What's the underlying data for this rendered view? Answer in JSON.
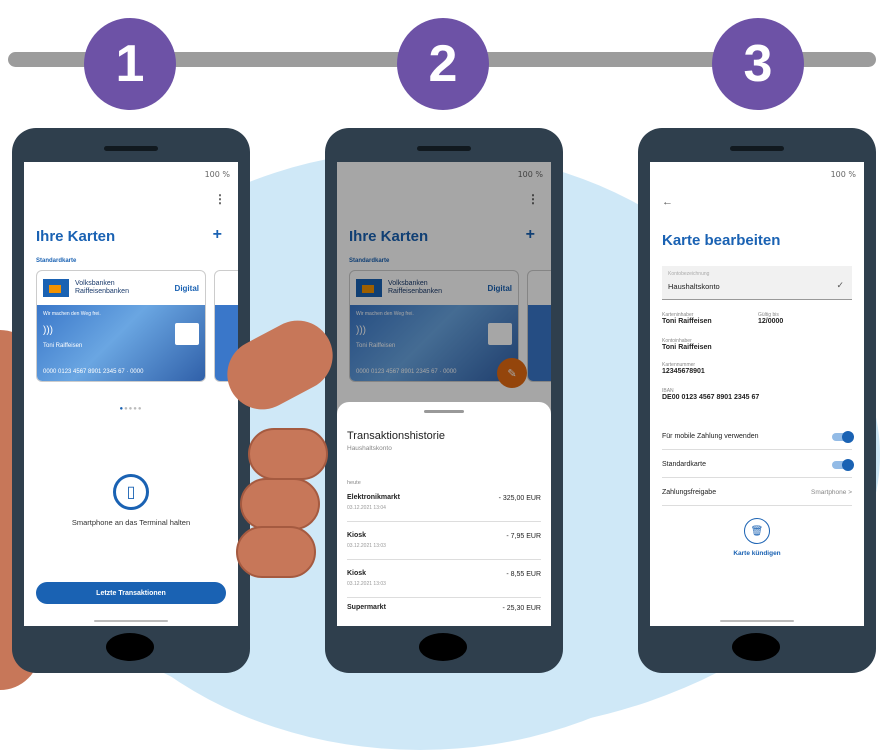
{
  "steps": [
    "1",
    "2",
    "3"
  ],
  "status_bar": "100 %",
  "phone1": {
    "title": "Ihre Karten",
    "add": "+",
    "section": "Standardkarte",
    "card": {
      "bank_line1": "Volksbanken",
      "bank_line2": "Raiffeisenbanken",
      "type": "Digital",
      "slogan": "Wir machen den Weg frei.",
      "holder": "Toni Raiffeisen",
      "number": "0000 0123 4567 8901 2345 67 · 0000"
    },
    "hint": "Smartphone an das Terminal halten",
    "button": "Letzte Transaktionen"
  },
  "phone2": {
    "sheet_title": "Transaktionshistorie",
    "sheet_subtitle": "Haushaltskonto",
    "today": "heute",
    "transactions": [
      {
        "name": "Elektronikmarkt",
        "date": "03.12.2021 13:04",
        "amount": "- 325,00 EUR"
      },
      {
        "name": "Kiosk",
        "date": "03.12.2021 13:03",
        "amount": "- 7,95 EUR"
      },
      {
        "name": "Kiosk",
        "date": "03.12.2021 13:03",
        "amount": "- 8,55 EUR"
      },
      {
        "name": "Supermarkt",
        "date": "",
        "amount": "- 25,30 EUR"
      }
    ]
  },
  "phone3": {
    "back": "←",
    "title": "Karte bearbeiten",
    "field_placeholder": "Kontobezeichnung",
    "field_value": "Haushaltskonto",
    "cardholder_label": "Karteninhaber",
    "cardholder": "Toni Raiffeisen",
    "valid_label": "Gültig bis",
    "valid": "12/0000",
    "account_holder_label": "Kontoinhaber",
    "account_holder": "Toni Raiffeisen",
    "card_number_label": "Kartennummer",
    "card_number": "12345678901",
    "iban_label": "IBAN",
    "iban": "DE00 0123 4567 8901 2345 67",
    "mobile_pay": "Für mobile Zahlung verwenden",
    "default_card": "Standardkarte",
    "approval": "Zahlungsfreigabe",
    "approval_value": "Smartphone >",
    "cancel": "Karte kündigen"
  }
}
